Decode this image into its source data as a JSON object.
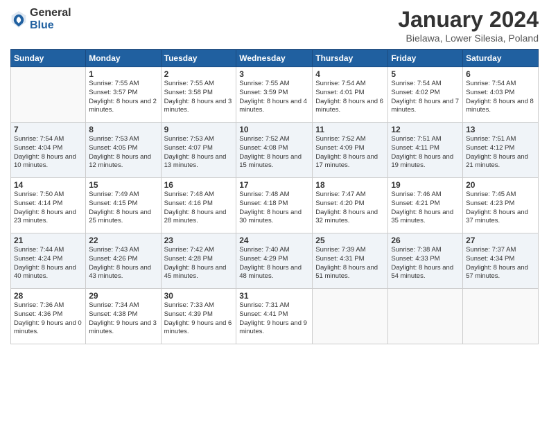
{
  "logo": {
    "general": "General",
    "blue": "Blue"
  },
  "title": "January 2024",
  "location": "Bielawa, Lower Silesia, Poland",
  "weekdays": [
    "Sunday",
    "Monday",
    "Tuesday",
    "Wednesday",
    "Thursday",
    "Friday",
    "Saturday"
  ],
  "weeks": [
    [
      {
        "day": null
      },
      {
        "day": "1",
        "sunrise": "Sunrise: 7:55 AM",
        "sunset": "Sunset: 3:57 PM",
        "daylight": "Daylight: 8 hours and 2 minutes."
      },
      {
        "day": "2",
        "sunrise": "Sunrise: 7:55 AM",
        "sunset": "Sunset: 3:58 PM",
        "daylight": "Daylight: 8 hours and 3 minutes."
      },
      {
        "day": "3",
        "sunrise": "Sunrise: 7:55 AM",
        "sunset": "Sunset: 3:59 PM",
        "daylight": "Daylight: 8 hours and 4 minutes."
      },
      {
        "day": "4",
        "sunrise": "Sunrise: 7:54 AM",
        "sunset": "Sunset: 4:01 PM",
        "daylight": "Daylight: 8 hours and 6 minutes."
      },
      {
        "day": "5",
        "sunrise": "Sunrise: 7:54 AM",
        "sunset": "Sunset: 4:02 PM",
        "daylight": "Daylight: 8 hours and 7 minutes."
      },
      {
        "day": "6",
        "sunrise": "Sunrise: 7:54 AM",
        "sunset": "Sunset: 4:03 PM",
        "daylight": "Daylight: 8 hours and 8 minutes."
      }
    ],
    [
      {
        "day": "7",
        "sunrise": "Sunrise: 7:54 AM",
        "sunset": "Sunset: 4:04 PM",
        "daylight": "Daylight: 8 hours and 10 minutes."
      },
      {
        "day": "8",
        "sunrise": "Sunrise: 7:53 AM",
        "sunset": "Sunset: 4:05 PM",
        "daylight": "Daylight: 8 hours and 12 minutes."
      },
      {
        "day": "9",
        "sunrise": "Sunrise: 7:53 AM",
        "sunset": "Sunset: 4:07 PM",
        "daylight": "Daylight: 8 hours and 13 minutes."
      },
      {
        "day": "10",
        "sunrise": "Sunrise: 7:52 AM",
        "sunset": "Sunset: 4:08 PM",
        "daylight": "Daylight: 8 hours and 15 minutes."
      },
      {
        "day": "11",
        "sunrise": "Sunrise: 7:52 AM",
        "sunset": "Sunset: 4:09 PM",
        "daylight": "Daylight: 8 hours and 17 minutes."
      },
      {
        "day": "12",
        "sunrise": "Sunrise: 7:51 AM",
        "sunset": "Sunset: 4:11 PM",
        "daylight": "Daylight: 8 hours and 19 minutes."
      },
      {
        "day": "13",
        "sunrise": "Sunrise: 7:51 AM",
        "sunset": "Sunset: 4:12 PM",
        "daylight": "Daylight: 8 hours and 21 minutes."
      }
    ],
    [
      {
        "day": "14",
        "sunrise": "Sunrise: 7:50 AM",
        "sunset": "Sunset: 4:14 PM",
        "daylight": "Daylight: 8 hours and 23 minutes."
      },
      {
        "day": "15",
        "sunrise": "Sunrise: 7:49 AM",
        "sunset": "Sunset: 4:15 PM",
        "daylight": "Daylight: 8 hours and 25 minutes."
      },
      {
        "day": "16",
        "sunrise": "Sunrise: 7:48 AM",
        "sunset": "Sunset: 4:16 PM",
        "daylight": "Daylight: 8 hours and 28 minutes."
      },
      {
        "day": "17",
        "sunrise": "Sunrise: 7:48 AM",
        "sunset": "Sunset: 4:18 PM",
        "daylight": "Daylight: 8 hours and 30 minutes."
      },
      {
        "day": "18",
        "sunrise": "Sunrise: 7:47 AM",
        "sunset": "Sunset: 4:20 PM",
        "daylight": "Daylight: 8 hours and 32 minutes."
      },
      {
        "day": "19",
        "sunrise": "Sunrise: 7:46 AM",
        "sunset": "Sunset: 4:21 PM",
        "daylight": "Daylight: 8 hours and 35 minutes."
      },
      {
        "day": "20",
        "sunrise": "Sunrise: 7:45 AM",
        "sunset": "Sunset: 4:23 PM",
        "daylight": "Daylight: 8 hours and 37 minutes."
      }
    ],
    [
      {
        "day": "21",
        "sunrise": "Sunrise: 7:44 AM",
        "sunset": "Sunset: 4:24 PM",
        "daylight": "Daylight: 8 hours and 40 minutes."
      },
      {
        "day": "22",
        "sunrise": "Sunrise: 7:43 AM",
        "sunset": "Sunset: 4:26 PM",
        "daylight": "Daylight: 8 hours and 43 minutes."
      },
      {
        "day": "23",
        "sunrise": "Sunrise: 7:42 AM",
        "sunset": "Sunset: 4:28 PM",
        "daylight": "Daylight: 8 hours and 45 minutes."
      },
      {
        "day": "24",
        "sunrise": "Sunrise: 7:40 AM",
        "sunset": "Sunset: 4:29 PM",
        "daylight": "Daylight: 8 hours and 48 minutes."
      },
      {
        "day": "25",
        "sunrise": "Sunrise: 7:39 AM",
        "sunset": "Sunset: 4:31 PM",
        "daylight": "Daylight: 8 hours and 51 minutes."
      },
      {
        "day": "26",
        "sunrise": "Sunrise: 7:38 AM",
        "sunset": "Sunset: 4:33 PM",
        "daylight": "Daylight: 8 hours and 54 minutes."
      },
      {
        "day": "27",
        "sunrise": "Sunrise: 7:37 AM",
        "sunset": "Sunset: 4:34 PM",
        "daylight": "Daylight: 8 hours and 57 minutes."
      }
    ],
    [
      {
        "day": "28",
        "sunrise": "Sunrise: 7:36 AM",
        "sunset": "Sunset: 4:36 PM",
        "daylight": "Daylight: 9 hours and 0 minutes."
      },
      {
        "day": "29",
        "sunrise": "Sunrise: 7:34 AM",
        "sunset": "Sunset: 4:38 PM",
        "daylight": "Daylight: 9 hours and 3 minutes."
      },
      {
        "day": "30",
        "sunrise": "Sunrise: 7:33 AM",
        "sunset": "Sunset: 4:39 PM",
        "daylight": "Daylight: 9 hours and 6 minutes."
      },
      {
        "day": "31",
        "sunrise": "Sunrise: 7:31 AM",
        "sunset": "Sunset: 4:41 PM",
        "daylight": "Daylight: 9 hours and 9 minutes."
      },
      {
        "day": null
      },
      {
        "day": null
      },
      {
        "day": null
      }
    ]
  ]
}
